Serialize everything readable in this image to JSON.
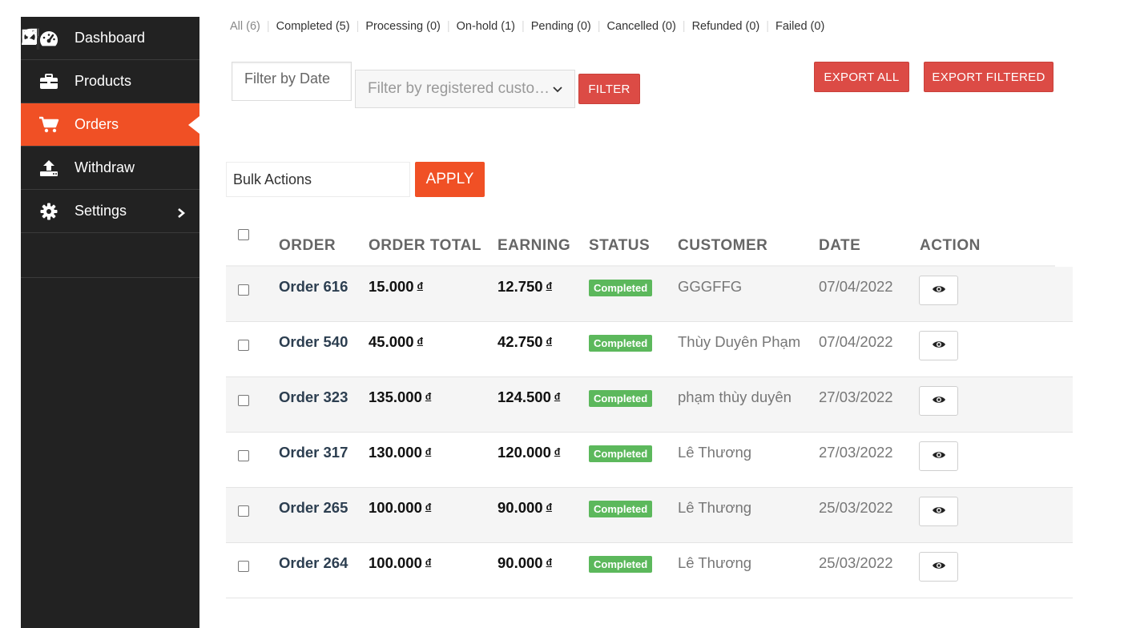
{
  "sidebar": {
    "items": [
      {
        "label": "Dashboard",
        "icon": "dashboard-gauge-icon"
      },
      {
        "label": "Products",
        "icon": "briefcase-icon"
      },
      {
        "label": "Orders",
        "icon": "cart-icon",
        "active": true
      },
      {
        "label": "Withdraw",
        "icon": "upload-icon"
      },
      {
        "label": "Settings",
        "icon": "gear-icon"
      }
    ],
    "bottom_icons": [
      "external-link-icon",
      "user-icon",
      "power-icon"
    ]
  },
  "status_tabs": [
    {
      "label": "All",
      "count": "(6)"
    },
    {
      "label": "Completed",
      "count": "(5)"
    },
    {
      "label": "Processing",
      "count": "(0)"
    },
    {
      "label": "On-hold",
      "count": "(1)"
    },
    {
      "label": "Pending",
      "count": "(0)"
    },
    {
      "label": "Cancelled",
      "count": "(0)"
    },
    {
      "label": "Refunded",
      "count": "(0)"
    },
    {
      "label": "Failed",
      "count": "(0)"
    }
  ],
  "filters": {
    "date_placeholder": "Filter by Date",
    "customer_placeholder": "Filter by registered custo…",
    "filter_label": "FILTER",
    "export_all_label": "EXPORT ALL",
    "export_filtered_label": "EXPORT FILTERED"
  },
  "bulk": {
    "select_value": "Bulk Actions",
    "apply_label": "APPLY"
  },
  "table": {
    "headers": {
      "order": "ORDER",
      "total": "ORDER TOTAL",
      "earning": "EARNING",
      "status": "STATUS",
      "customer": "CUSTOMER",
      "date": "DATE",
      "action": "ACTION"
    },
    "currency": "đ",
    "rows": [
      {
        "order": "Order 616",
        "total": "15.000",
        "earning": "12.750",
        "status": "Completed",
        "customer": "GGGFFG",
        "date": "07/04/2022"
      },
      {
        "order": "Order 540",
        "total": "45.000",
        "earning": "42.750",
        "status": "Completed",
        "customer": "Thùy Duyên Phạm",
        "date": "07/04/2022"
      },
      {
        "order": "Order 323",
        "total": "135.000",
        "earning": "124.500",
        "status": "Completed",
        "customer": "phạm thùy duyên",
        "date": "27/03/2022"
      },
      {
        "order": "Order 317",
        "total": "130.000",
        "earning": "120.000",
        "status": "Completed",
        "customer": "Lê Thương",
        "date": "27/03/2022"
      },
      {
        "order": "Order 265",
        "total": "100.000",
        "earning": "90.000",
        "status": "Completed",
        "customer": "Lê Thương",
        "date": "25/03/2022"
      },
      {
        "order": "Order 264",
        "total": "100.000",
        "earning": "90.000",
        "status": "Completed",
        "customer": "Lê Thương",
        "date": "25/03/2022"
      }
    ]
  },
  "colors": {
    "sidebar_bg": "#222222",
    "accent_orange": "#f05025",
    "button_red": "#dc4b45",
    "badge_green": "#5cb85c"
  }
}
